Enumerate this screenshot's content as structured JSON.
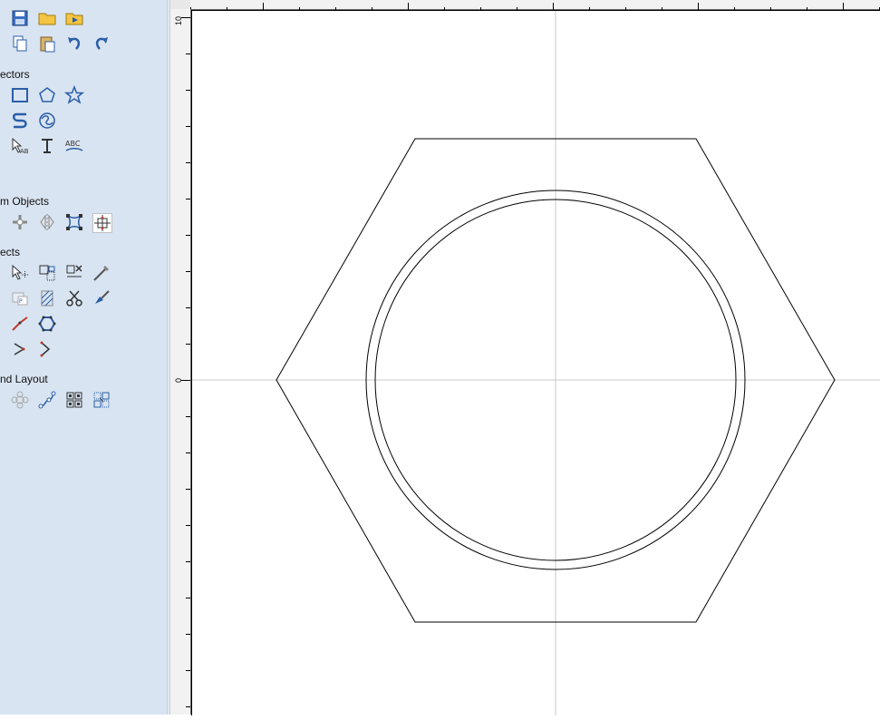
{
  "toolbox": {
    "sections": [
      {
        "title": "ectors"
      },
      {
        "title": "m Objects"
      },
      {
        "title": "ects"
      },
      {
        "title": "nd Layout"
      }
    ],
    "tools": {
      "row1": [
        "open-icon",
        "save-icon",
        "open-folder-icon",
        "import-icon"
      ],
      "row2": [
        "cut-icon",
        "copy-icon",
        "paste-icon",
        "undo-icon",
        "redo-icon"
      ],
      "row3": [
        "ellipse-icon",
        "rectangle-icon",
        "polygon-icon",
        "star-icon"
      ],
      "row4": [
        "triangle-icon",
        "spline-icon",
        "spiral-icon"
      ],
      "row5": [
        "node-edit-icon",
        "select-text-icon",
        "text-tool-icon",
        "text-on-curve-icon"
      ],
      "row6": [
        "extra-icon"
      ],
      "row7": [
        "transform-a-icon",
        "move-icon",
        "mirror-icon",
        "distort-icon",
        "align-center-icon"
      ],
      "row8": [
        "add-icon",
        "select-nodes-icon",
        "group-icon",
        "delete-object-icon",
        "measure-icon"
      ],
      "row9": [
        "weld-icon",
        "trim-icon",
        "hatch-icon",
        "scissors-icon",
        "brush-icon"
      ],
      "row10": [
        "pen-icon",
        "line-edit-icon",
        "polyline-icon"
      ],
      "row11": [
        "curve-a-icon",
        "curve-b-icon"
      ],
      "row12": [
        "array-icon",
        "nest-icon",
        "path-icon",
        "grid-icon",
        "matrix-icon"
      ]
    }
  },
  "rulers": {
    "top_label": "",
    "left_labels": [
      "10",
      "0"
    ]
  },
  "colors": {
    "panel": "#d8e4f1",
    "icon_blue": "#2a5ea8",
    "guide": "#c8c8c8",
    "shape_stroke": "#000000"
  },
  "drawing": {
    "shapes": [
      "hexagon",
      "outer-circle",
      "inner-circle"
    ]
  }
}
